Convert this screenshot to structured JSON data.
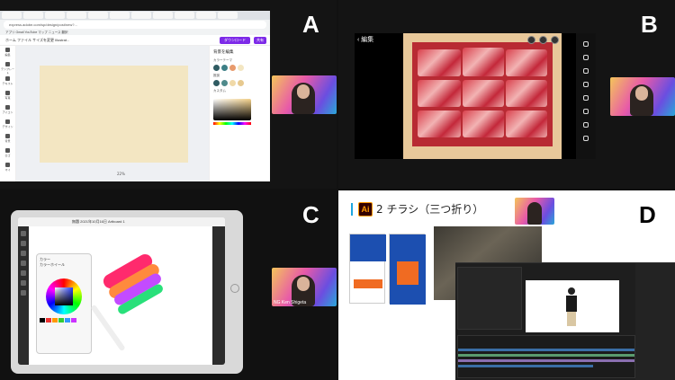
{
  "quadrants": {
    "a": {
      "letter": "A"
    },
    "b": {
      "letter": "B"
    },
    "c": {
      "letter": "C"
    },
    "d": {
      "letter": "D"
    }
  },
  "quad_a": {
    "address": "express.adobe.com/sp/design/post/new?...",
    "bookmarks": "アプリ  Gmail  YouTube  マップ  ニュース  翻訳",
    "doc_title": "ホーム  ファイル  サイズを変更  Illustrat...",
    "download_label": "ダウンロード",
    "share_label": "共有",
    "zoom_label": "22%",
    "side_items": [
      "編集",
      "テンプレート",
      "テキスト",
      "写真",
      "アイコン",
      "デザイン",
      "背景",
      "ロゴ",
      "マイ"
    ],
    "panel_title": "背景を編集",
    "panel_sub1": "カラーテーマ",
    "panel_sub2": "推奨",
    "panel_sub3": "カスタム"
  },
  "quad_b": {
    "edit_label": "編集"
  },
  "quad_c": {
    "top_title": "無題  2021年10月16日  Artboard 1",
    "popup_label": "カラー",
    "popup_sub": "カラーホイール",
    "webcam_tag": "NG  Ken Shigeta"
  },
  "quad_d": {
    "slide_title": "2 チラシ（三つ折り）",
    "ai_badge": "Ai"
  },
  "colors": {
    "canvas_page": "#f3e6c2",
    "express_purple": "#7d2ae8",
    "ai_orange": "#ff9a00"
  }
}
